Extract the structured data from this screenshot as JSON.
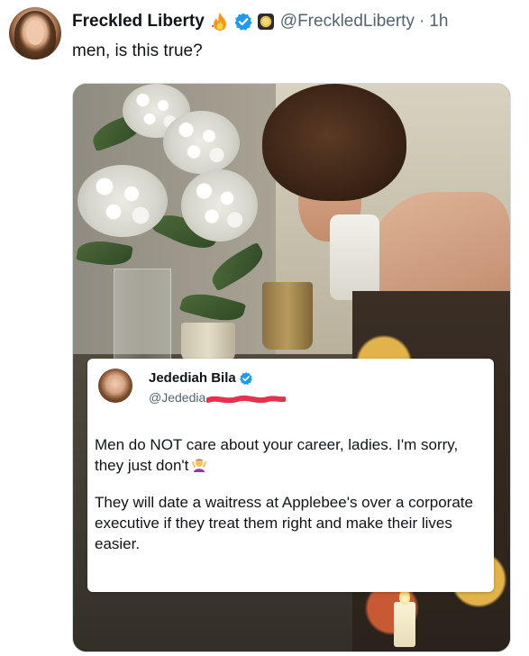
{
  "post": {
    "author_name": "Freckled Liberty",
    "author_handle": "@FreckledLiberty",
    "separator": "·",
    "timestamp": "1h",
    "text": "men, is this true?",
    "icons": [
      "fire-icon",
      "verified-icon",
      "gold-badge-icon"
    ]
  },
  "embedded_tweet": {
    "author_name": "Jedediah Bila",
    "author_handle_visible": "@Jededia",
    "paragraph_1": "Men do NOT care about your career, ladies. I'm sorry, they just don't",
    "paragraph_2": "They will date a waitress at Applebee's over a corporate executive if they treat them right and make their lives easier.",
    "icons": [
      "verified-icon",
      "woman-gesturing-emoji-icon"
    ]
  },
  "colors": {
    "verified_blue": "#1d9bf0",
    "text_primary": "#0f1419",
    "text_secondary": "#536471",
    "redaction_pink": "#e8304f"
  }
}
